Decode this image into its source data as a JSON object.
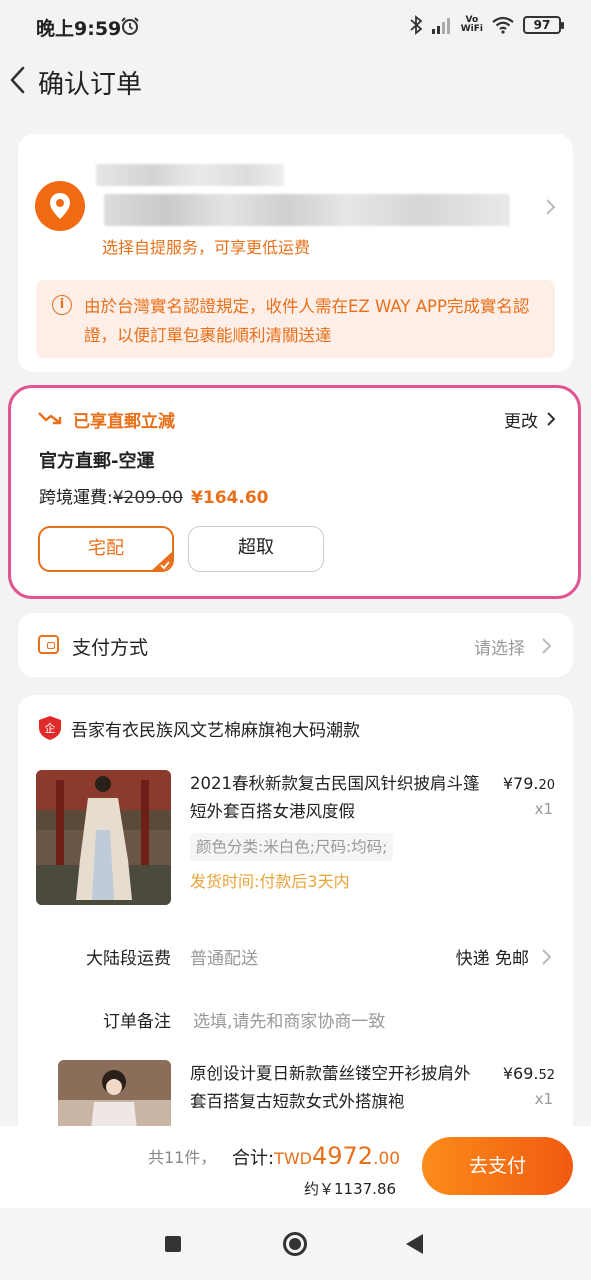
{
  "status_bar": {
    "time": "晚上9:59",
    "network": "Vo\nWiFi",
    "battery": "97"
  },
  "header": {
    "title": "确认订单"
  },
  "address": {
    "pickup_hint": "选择自提服务，可享更低运费",
    "notice": "由於台灣實名認證規定，收件人需在EZ WAY APP完成實名認證，以便訂單包裹能順利清關送達"
  },
  "shipping": {
    "discount_label": "已享直郵立減",
    "change_label": "更改",
    "method": "官方直郵-空運",
    "fee_label": "跨境運費:",
    "fee_old": "¥209.00",
    "fee_new": "¥164.60",
    "option_home": "宅配",
    "option_pickup": "超取"
  },
  "payment": {
    "label": "支付方式",
    "choose": "请选择"
  },
  "shop": {
    "name": "吾家有衣民族风文艺棉麻旗袍大码潮款",
    "items": [
      {
        "name": "2021春秋新款复古民国风针织披肩斗篷短外套百搭女港风度假",
        "price_int": "¥79.",
        "price_dec": "20",
        "qty": "x1",
        "sku": "颜色分类:米白色;尺码:均码;",
        "dispatch": "发货时间:付款后3天内"
      },
      {
        "name": "原创设计夏日新款蕾丝镂空开衫披肩外套百搭复古短款女式外搭旗袍",
        "price_int": "¥69.",
        "price_dec": "52",
        "qty": "x1"
      }
    ],
    "freight_label": "大陆段运费",
    "freight_value": "普通配送",
    "freight_right": "快递 免邮",
    "remark_label": "订单备注",
    "remark_placeholder": "选填,请先和商家协商一致"
  },
  "summary": {
    "count": "共11件，",
    "total_label": "合计:",
    "currency": "TWD",
    "total_int": "4972",
    "total_dec": ".00",
    "approx": "约￥1137.86",
    "pay_button": "去支付"
  },
  "colors": {
    "accent": "#e9701a",
    "highlight_border": "#e05494"
  }
}
